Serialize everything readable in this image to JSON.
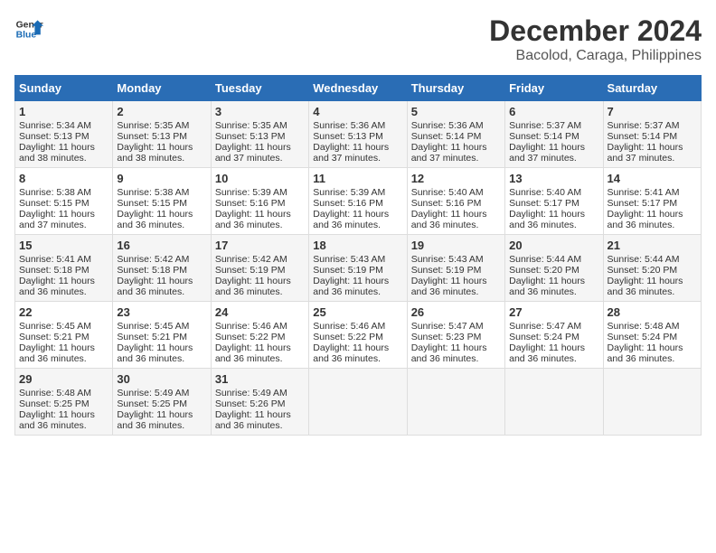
{
  "header": {
    "logo_line1": "General",
    "logo_line2": "Blue",
    "title": "December 2024",
    "subtitle": "Bacolod, Caraga, Philippines"
  },
  "calendar": {
    "columns": [
      "Sunday",
      "Monday",
      "Tuesday",
      "Wednesday",
      "Thursday",
      "Friday",
      "Saturday"
    ],
    "weeks": [
      [
        {
          "day": "",
          "content": ""
        },
        {
          "day": "",
          "content": ""
        },
        {
          "day": "",
          "content": ""
        },
        {
          "day": "",
          "content": ""
        },
        {
          "day": "",
          "content": ""
        },
        {
          "day": "",
          "content": ""
        },
        {
          "day": "",
          "content": ""
        }
      ],
      [
        {
          "day": "1",
          "content": "Sunrise: 5:34 AM\nSunset: 5:13 PM\nDaylight: 11 hours and 38 minutes."
        },
        {
          "day": "2",
          "content": "Sunrise: 5:35 AM\nSunset: 5:13 PM\nDaylight: 11 hours and 38 minutes."
        },
        {
          "day": "3",
          "content": "Sunrise: 5:35 AM\nSunset: 5:13 PM\nDaylight: 11 hours and 37 minutes."
        },
        {
          "day": "4",
          "content": "Sunrise: 5:36 AM\nSunset: 5:13 PM\nDaylight: 11 hours and 37 minutes."
        },
        {
          "day": "5",
          "content": "Sunrise: 5:36 AM\nSunset: 5:14 PM\nDaylight: 11 hours and 37 minutes."
        },
        {
          "day": "6",
          "content": "Sunrise: 5:37 AM\nSunset: 5:14 PM\nDaylight: 11 hours and 37 minutes."
        },
        {
          "day": "7",
          "content": "Sunrise: 5:37 AM\nSunset: 5:14 PM\nDaylight: 11 hours and 37 minutes."
        }
      ],
      [
        {
          "day": "8",
          "content": "Sunrise: 5:38 AM\nSunset: 5:15 PM\nDaylight: 11 hours and 37 minutes."
        },
        {
          "day": "9",
          "content": "Sunrise: 5:38 AM\nSunset: 5:15 PM\nDaylight: 11 hours and 36 minutes."
        },
        {
          "day": "10",
          "content": "Sunrise: 5:39 AM\nSunset: 5:16 PM\nDaylight: 11 hours and 36 minutes."
        },
        {
          "day": "11",
          "content": "Sunrise: 5:39 AM\nSunset: 5:16 PM\nDaylight: 11 hours and 36 minutes."
        },
        {
          "day": "12",
          "content": "Sunrise: 5:40 AM\nSunset: 5:16 PM\nDaylight: 11 hours and 36 minutes."
        },
        {
          "day": "13",
          "content": "Sunrise: 5:40 AM\nSunset: 5:17 PM\nDaylight: 11 hours and 36 minutes."
        },
        {
          "day": "14",
          "content": "Sunrise: 5:41 AM\nSunset: 5:17 PM\nDaylight: 11 hours and 36 minutes."
        }
      ],
      [
        {
          "day": "15",
          "content": "Sunrise: 5:41 AM\nSunset: 5:18 PM\nDaylight: 11 hours and 36 minutes."
        },
        {
          "day": "16",
          "content": "Sunrise: 5:42 AM\nSunset: 5:18 PM\nDaylight: 11 hours and 36 minutes."
        },
        {
          "day": "17",
          "content": "Sunrise: 5:42 AM\nSunset: 5:19 PM\nDaylight: 11 hours and 36 minutes."
        },
        {
          "day": "18",
          "content": "Sunrise: 5:43 AM\nSunset: 5:19 PM\nDaylight: 11 hours and 36 minutes."
        },
        {
          "day": "19",
          "content": "Sunrise: 5:43 AM\nSunset: 5:19 PM\nDaylight: 11 hours and 36 minutes."
        },
        {
          "day": "20",
          "content": "Sunrise: 5:44 AM\nSunset: 5:20 PM\nDaylight: 11 hours and 36 minutes."
        },
        {
          "day": "21",
          "content": "Sunrise: 5:44 AM\nSunset: 5:20 PM\nDaylight: 11 hours and 36 minutes."
        }
      ],
      [
        {
          "day": "22",
          "content": "Sunrise: 5:45 AM\nSunset: 5:21 PM\nDaylight: 11 hours and 36 minutes."
        },
        {
          "day": "23",
          "content": "Sunrise: 5:45 AM\nSunset: 5:21 PM\nDaylight: 11 hours and 36 minutes."
        },
        {
          "day": "24",
          "content": "Sunrise: 5:46 AM\nSunset: 5:22 PM\nDaylight: 11 hours and 36 minutes."
        },
        {
          "day": "25",
          "content": "Sunrise: 5:46 AM\nSunset: 5:22 PM\nDaylight: 11 hours and 36 minutes."
        },
        {
          "day": "26",
          "content": "Sunrise: 5:47 AM\nSunset: 5:23 PM\nDaylight: 11 hours and 36 minutes."
        },
        {
          "day": "27",
          "content": "Sunrise: 5:47 AM\nSunset: 5:24 PM\nDaylight: 11 hours and 36 minutes."
        },
        {
          "day": "28",
          "content": "Sunrise: 5:48 AM\nSunset: 5:24 PM\nDaylight: 11 hours and 36 minutes."
        }
      ],
      [
        {
          "day": "29",
          "content": "Sunrise: 5:48 AM\nSunset: 5:25 PM\nDaylight: 11 hours and 36 minutes."
        },
        {
          "day": "30",
          "content": "Sunrise: 5:49 AM\nSunset: 5:25 PM\nDaylight: 11 hours and 36 minutes."
        },
        {
          "day": "31",
          "content": "Sunrise: 5:49 AM\nSunset: 5:26 PM\nDaylight: 11 hours and 36 minutes."
        },
        {
          "day": "",
          "content": ""
        },
        {
          "day": "",
          "content": ""
        },
        {
          "day": "",
          "content": ""
        },
        {
          "day": "",
          "content": ""
        }
      ]
    ]
  }
}
